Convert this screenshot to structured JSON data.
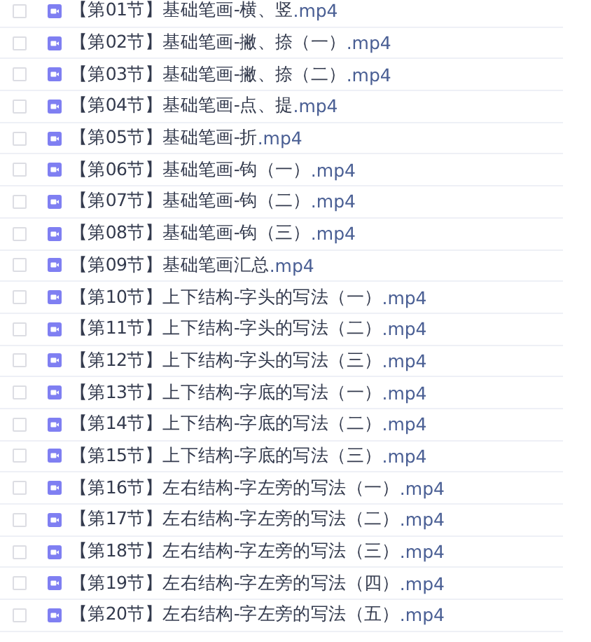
{
  "files": [
    {
      "name": "【第01节】基础笔画-横、竖",
      "ext": ".mp4",
      "checked": false
    },
    {
      "name": "【第02节】基础笔画-撇、捺（一）",
      "ext": ".mp4",
      "checked": false
    },
    {
      "name": "【第03节】基础笔画-撇、捺（二）",
      "ext": ".mp4",
      "checked": false
    },
    {
      "name": "【第04节】基础笔画-点、提",
      "ext": ".mp4",
      "checked": false
    },
    {
      "name": "【第05节】基础笔画-折",
      "ext": ".mp4",
      "checked": false
    },
    {
      "name": "【第06节】基础笔画-钩（一）",
      "ext": ".mp4",
      "checked": false
    },
    {
      "name": "【第07节】基础笔画-钩（二）",
      "ext": ".mp4",
      "checked": false
    },
    {
      "name": "【第08节】基础笔画-钩（三）",
      "ext": ".mp4",
      "checked": false
    },
    {
      "name": "【第09节】基础笔画汇总",
      "ext": ".mp4",
      "checked": false
    },
    {
      "name": "【第10节】上下结构-字头的写法（一）",
      "ext": ".mp4",
      "checked": false
    },
    {
      "name": "【第11节】上下结构-字头的写法（二）",
      "ext": ".mp4",
      "checked": false
    },
    {
      "name": "【第12节】上下结构-字头的写法（三）",
      "ext": ".mp4",
      "checked": false
    },
    {
      "name": "【第13节】上下结构-字底的写法（一）",
      "ext": ".mp4",
      "checked": false
    },
    {
      "name": "【第14节】上下结构-字底的写法（二）",
      "ext": ".mp4",
      "checked": false
    },
    {
      "name": "【第15节】上下结构-字底的写法（三）",
      "ext": ".mp4",
      "checked": false
    },
    {
      "name": "【第16节】左右结构-字左旁的写法（一）",
      "ext": ".mp4",
      "checked": false
    },
    {
      "name": "【第17节】左右结构-字左旁的写法（二）",
      "ext": ".mp4",
      "checked": false
    },
    {
      "name": "【第18节】左右结构-字左旁的写法（三）",
      "ext": ".mp4",
      "checked": false
    },
    {
      "name": "【第19节】左右结构-字左旁的写法（四）",
      "ext": ".mp4",
      "checked": false
    },
    {
      "name": "【第20节】左右结构-字左旁的写法（五）",
      "ext": ".mp4",
      "checked": false
    }
  ]
}
